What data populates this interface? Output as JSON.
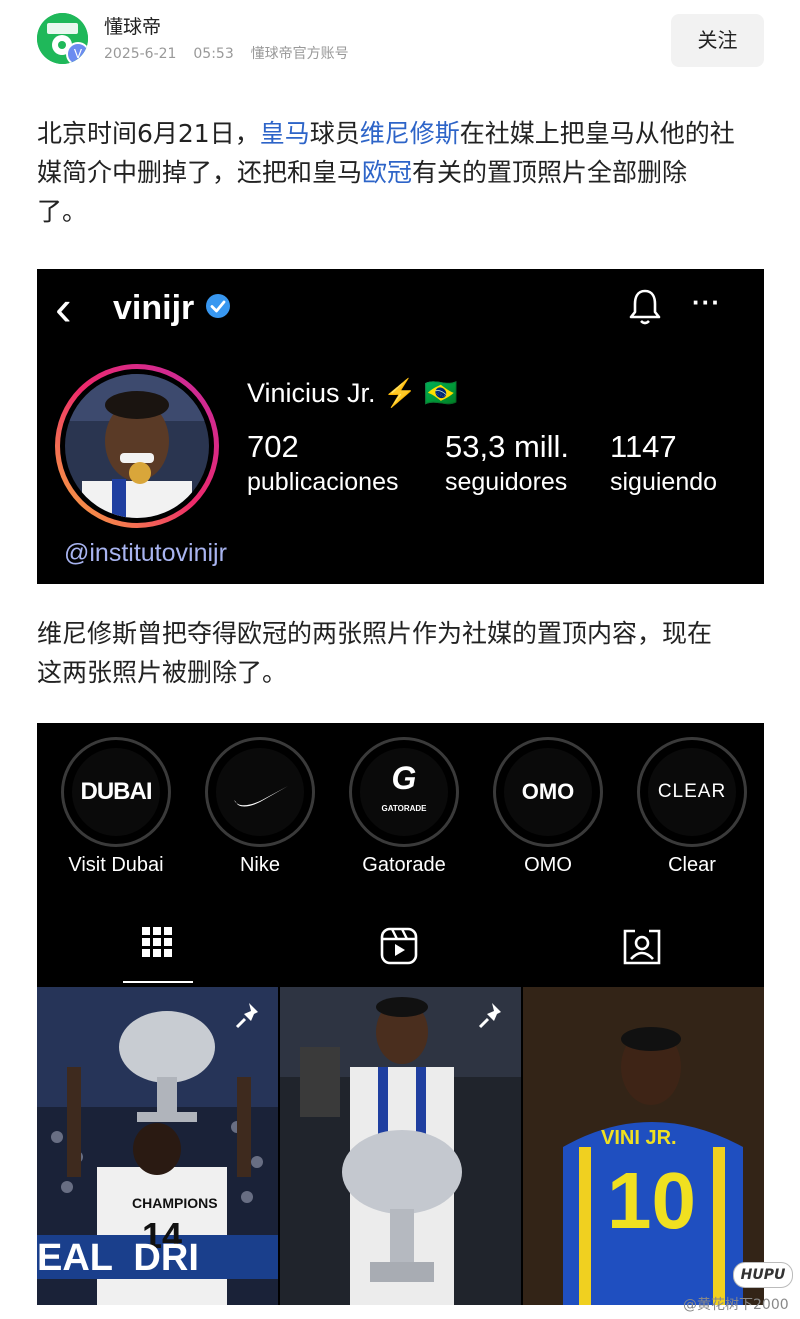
{
  "account": {
    "name": "懂球帝",
    "date": "2025-6-21",
    "time": "05:53",
    "source": "懂球帝官方账号",
    "follow_label": "关注",
    "verified_mark": "V"
  },
  "article": {
    "p1": {
      "t1": "北京时间6月21日，",
      "link1": "皇马",
      "t2": "球员",
      "link2": "维尼修斯",
      "t3": "在社媒上把皇马从他的社",
      "t4": "媒简介中删掉了，还把和皇马",
      "link3": "欧冠",
      "t5": "有关的置顶照片全部删除",
      "t6": "了。"
    },
    "p2": {
      "l1": "维尼修斯曾把夺得欧冠的两张照片作为社媒的置顶内容，现在",
      "l2": "这两张照片被删除了。"
    }
  },
  "profile": {
    "username": "vinijr",
    "display_name": "Vinicius Jr.",
    "display_emoji": "⚡ 🇧🇷",
    "posts_count": "702",
    "posts_label": "publicaciones",
    "followers_count": "53,3 mill.",
    "followers_label": "seguidores",
    "following_count": "1147",
    "following_label": "siguiendo",
    "bio_link": "@institutovinijr",
    "back_glyph": "‹",
    "more_glyph": "···"
  },
  "highlights": [
    {
      "label": "Visit Dubai",
      "logo": "DUBAI"
    },
    {
      "label": "Nike",
      "logo": ""
    },
    {
      "label": "Gatorade",
      "logo": "G"
    },
    {
      "label": "OMO",
      "logo": "OMO"
    },
    {
      "label": "Clear",
      "logo": "CLEAR"
    }
  ],
  "photos": {
    "p1_jersey": "CHAMPIONS",
    "p1_number": "14",
    "p1_banner": "EAL  DRI",
    "p3_jersey": "VINI JR.",
    "p3_number": "10",
    "gatorade_sub": "GATORADE"
  },
  "watermark": {
    "brand": "HUPU",
    "handle": "@黄花树下2000"
  },
  "colors": {
    "link": "#2d64c8",
    "brand_green": "#1fb85a",
    "verified_blue": "#3897f0",
    "card_bg": "#000000"
  }
}
